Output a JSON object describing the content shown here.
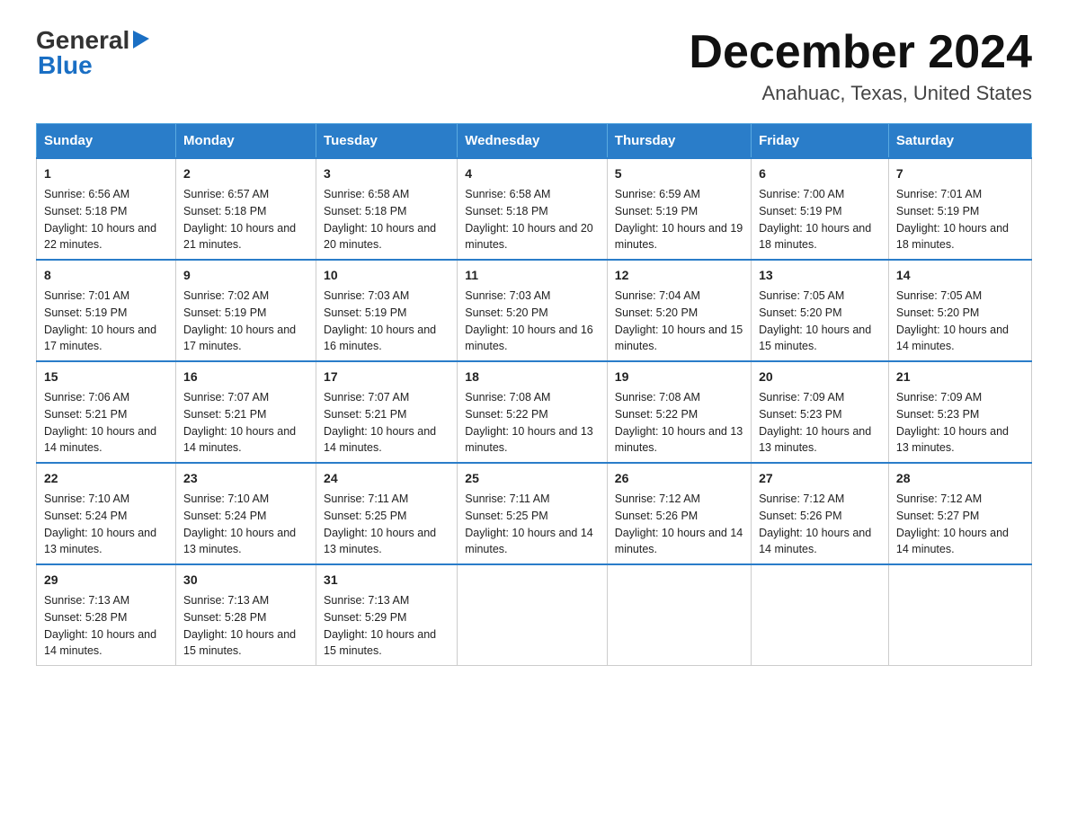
{
  "header": {
    "logo_general": "General",
    "logo_blue": "Blue",
    "title": "December 2024",
    "subtitle": "Anahuac, Texas, United States"
  },
  "days_of_week": [
    "Sunday",
    "Monday",
    "Tuesday",
    "Wednesday",
    "Thursday",
    "Friday",
    "Saturday"
  ],
  "weeks": [
    [
      {
        "day": "1",
        "sunrise": "6:56 AM",
        "sunset": "5:18 PM",
        "daylight": "10 hours and 22 minutes."
      },
      {
        "day": "2",
        "sunrise": "6:57 AM",
        "sunset": "5:18 PM",
        "daylight": "10 hours and 21 minutes."
      },
      {
        "day": "3",
        "sunrise": "6:58 AM",
        "sunset": "5:18 PM",
        "daylight": "10 hours and 20 minutes."
      },
      {
        "day": "4",
        "sunrise": "6:58 AM",
        "sunset": "5:18 PM",
        "daylight": "10 hours and 20 minutes."
      },
      {
        "day": "5",
        "sunrise": "6:59 AM",
        "sunset": "5:19 PM",
        "daylight": "10 hours and 19 minutes."
      },
      {
        "day": "6",
        "sunrise": "7:00 AM",
        "sunset": "5:19 PM",
        "daylight": "10 hours and 18 minutes."
      },
      {
        "day": "7",
        "sunrise": "7:01 AM",
        "sunset": "5:19 PM",
        "daylight": "10 hours and 18 minutes."
      }
    ],
    [
      {
        "day": "8",
        "sunrise": "7:01 AM",
        "sunset": "5:19 PM",
        "daylight": "10 hours and 17 minutes."
      },
      {
        "day": "9",
        "sunrise": "7:02 AM",
        "sunset": "5:19 PM",
        "daylight": "10 hours and 17 minutes."
      },
      {
        "day": "10",
        "sunrise": "7:03 AM",
        "sunset": "5:19 PM",
        "daylight": "10 hours and 16 minutes."
      },
      {
        "day": "11",
        "sunrise": "7:03 AM",
        "sunset": "5:20 PM",
        "daylight": "10 hours and 16 minutes."
      },
      {
        "day": "12",
        "sunrise": "7:04 AM",
        "sunset": "5:20 PM",
        "daylight": "10 hours and 15 minutes."
      },
      {
        "day": "13",
        "sunrise": "7:05 AM",
        "sunset": "5:20 PM",
        "daylight": "10 hours and 15 minutes."
      },
      {
        "day": "14",
        "sunrise": "7:05 AM",
        "sunset": "5:20 PM",
        "daylight": "10 hours and 14 minutes."
      }
    ],
    [
      {
        "day": "15",
        "sunrise": "7:06 AM",
        "sunset": "5:21 PM",
        "daylight": "10 hours and 14 minutes."
      },
      {
        "day": "16",
        "sunrise": "7:07 AM",
        "sunset": "5:21 PM",
        "daylight": "10 hours and 14 minutes."
      },
      {
        "day": "17",
        "sunrise": "7:07 AM",
        "sunset": "5:21 PM",
        "daylight": "10 hours and 14 minutes."
      },
      {
        "day": "18",
        "sunrise": "7:08 AM",
        "sunset": "5:22 PM",
        "daylight": "10 hours and 13 minutes."
      },
      {
        "day": "19",
        "sunrise": "7:08 AM",
        "sunset": "5:22 PM",
        "daylight": "10 hours and 13 minutes."
      },
      {
        "day": "20",
        "sunrise": "7:09 AM",
        "sunset": "5:23 PM",
        "daylight": "10 hours and 13 minutes."
      },
      {
        "day": "21",
        "sunrise": "7:09 AM",
        "sunset": "5:23 PM",
        "daylight": "10 hours and 13 minutes."
      }
    ],
    [
      {
        "day": "22",
        "sunrise": "7:10 AM",
        "sunset": "5:24 PM",
        "daylight": "10 hours and 13 minutes."
      },
      {
        "day": "23",
        "sunrise": "7:10 AM",
        "sunset": "5:24 PM",
        "daylight": "10 hours and 13 minutes."
      },
      {
        "day": "24",
        "sunrise": "7:11 AM",
        "sunset": "5:25 PM",
        "daylight": "10 hours and 13 minutes."
      },
      {
        "day": "25",
        "sunrise": "7:11 AM",
        "sunset": "5:25 PM",
        "daylight": "10 hours and 14 minutes."
      },
      {
        "day": "26",
        "sunrise": "7:12 AM",
        "sunset": "5:26 PM",
        "daylight": "10 hours and 14 minutes."
      },
      {
        "day": "27",
        "sunrise": "7:12 AM",
        "sunset": "5:26 PM",
        "daylight": "10 hours and 14 minutes."
      },
      {
        "day": "28",
        "sunrise": "7:12 AM",
        "sunset": "5:27 PM",
        "daylight": "10 hours and 14 minutes."
      }
    ],
    [
      {
        "day": "29",
        "sunrise": "7:13 AM",
        "sunset": "5:28 PM",
        "daylight": "10 hours and 14 minutes."
      },
      {
        "day": "30",
        "sunrise": "7:13 AM",
        "sunset": "5:28 PM",
        "daylight": "10 hours and 15 minutes."
      },
      {
        "day": "31",
        "sunrise": "7:13 AM",
        "sunset": "5:29 PM",
        "daylight": "10 hours and 15 minutes."
      },
      null,
      null,
      null,
      null
    ]
  ]
}
